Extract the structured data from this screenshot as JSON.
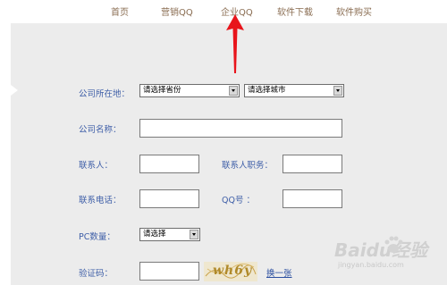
{
  "nav": {
    "items": [
      "首页",
      "营销QQ",
      "企业QQ",
      "软件下载",
      "软件购买"
    ]
  },
  "form": {
    "location_label": "公司所在地：",
    "province_select": "请选择省份",
    "city_select": "请选择城市",
    "company_name_label": "公司名称：",
    "company_name_value": "",
    "contact_label": "联系人：",
    "contact_value": "",
    "contact_title_label": "联系人职务：",
    "contact_title_value": "",
    "phone_label": "联系电话：",
    "phone_value": "",
    "qq_label": "QQ号 ：",
    "qq_value": "",
    "pc_count_label": "PC数量：",
    "pc_count_select": "请选择",
    "captcha_label": "验证码：",
    "captcha_value": "",
    "captcha_text": "wh6y",
    "refresh_link": "换一张"
  },
  "watermark": {
    "text": "Baidu经验",
    "url": "jingyan.baidu.com"
  },
  "colors": {
    "nav_text": "#8a6d52",
    "label_text": "#3f5fa8",
    "panel_bg": "#ececec",
    "annotation_arrow": "#e8141b"
  },
  "icons": [
    "red-arrow-icon",
    "dropdown-arrow-icon",
    "baidu-paw-icon"
  ]
}
